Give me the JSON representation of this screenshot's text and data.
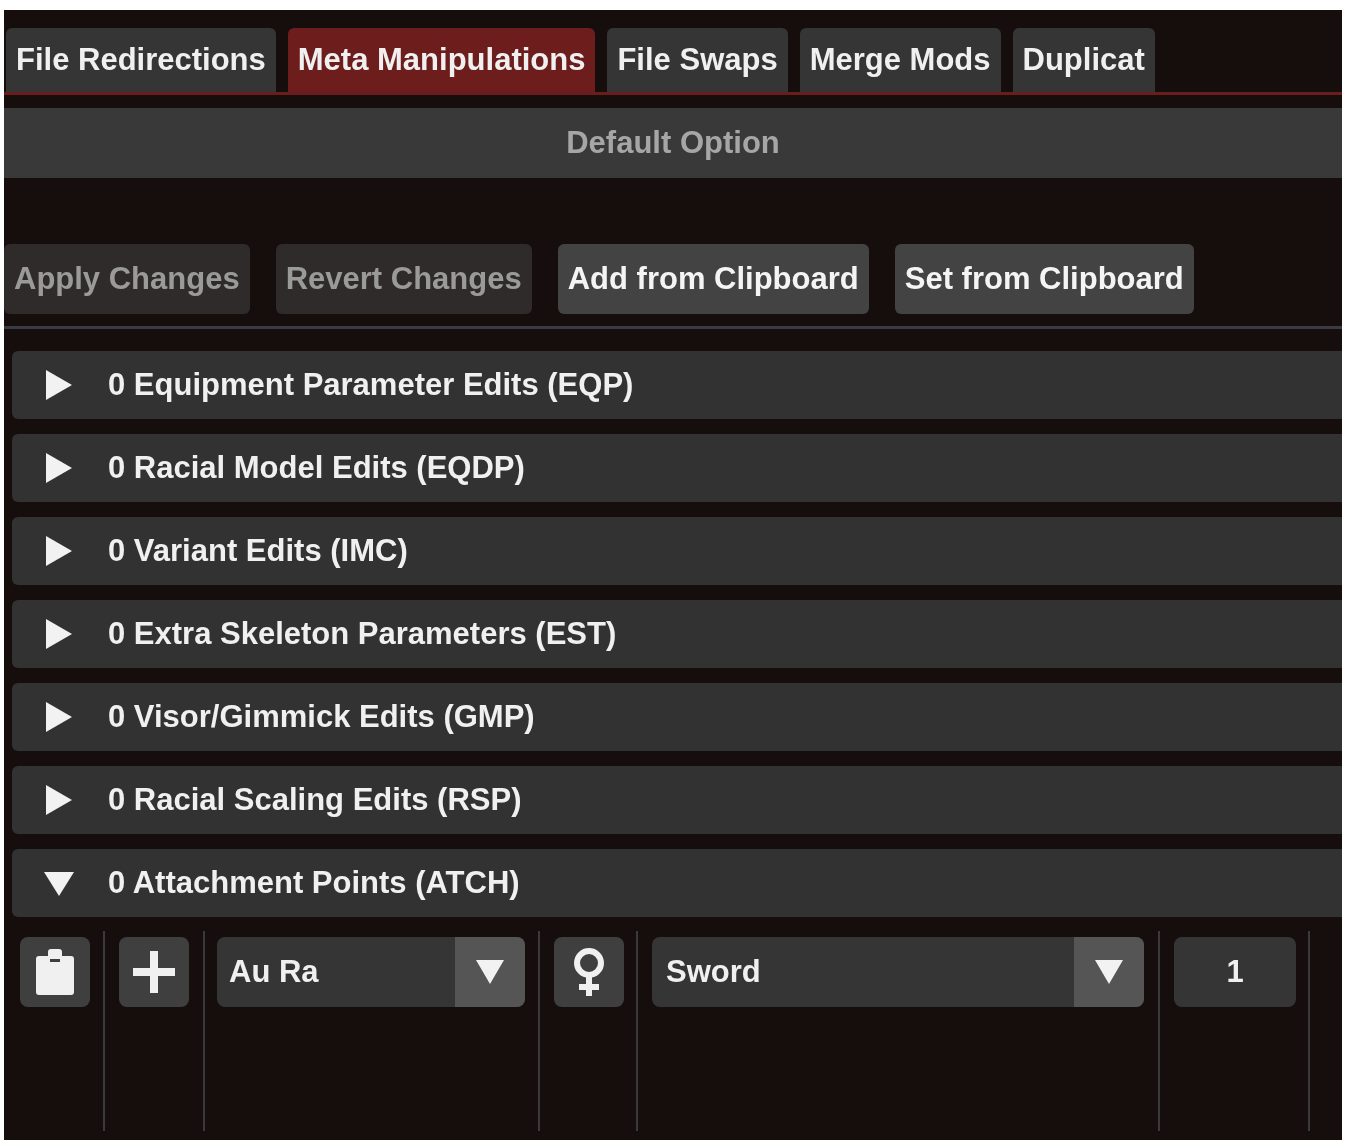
{
  "tabs": [
    {
      "label": "File Redirections",
      "selected": false
    },
    {
      "label": "Meta Manipulations",
      "selected": true
    },
    {
      "label": "File Swaps",
      "selected": false
    },
    {
      "label": "Merge Mods",
      "selected": false
    },
    {
      "label": "Duplicat",
      "selected": false
    }
  ],
  "option_bar": {
    "label": "Default Option",
    "disabled": true
  },
  "buttons": [
    {
      "label": "Apply Changes",
      "disabled": true
    },
    {
      "label": "Revert Changes",
      "disabled": true
    },
    {
      "label": "Add from Clipboard",
      "disabled": false
    },
    {
      "label": "Set from Clipboard",
      "disabled": false
    }
  ],
  "sections": [
    {
      "label": "0 Equipment Parameter Edits (EQP)",
      "expanded": false
    },
    {
      "label": "0 Racial Model Edits (EQDP)",
      "expanded": false
    },
    {
      "label": "0 Variant Edits (IMC)",
      "expanded": false
    },
    {
      "label": "0 Extra Skeleton Parameters (EST)",
      "expanded": false
    },
    {
      "label": "0 Visor/Gimmick Edits (GMP)",
      "expanded": false
    },
    {
      "label": "0 Racial Scaling Edits (RSP)",
      "expanded": false
    },
    {
      "label": "0 Attachment Points (ATCH)",
      "expanded": true
    }
  ],
  "attachment_row": {
    "race": "Au Ra",
    "type": "Sword",
    "index": "1"
  }
}
